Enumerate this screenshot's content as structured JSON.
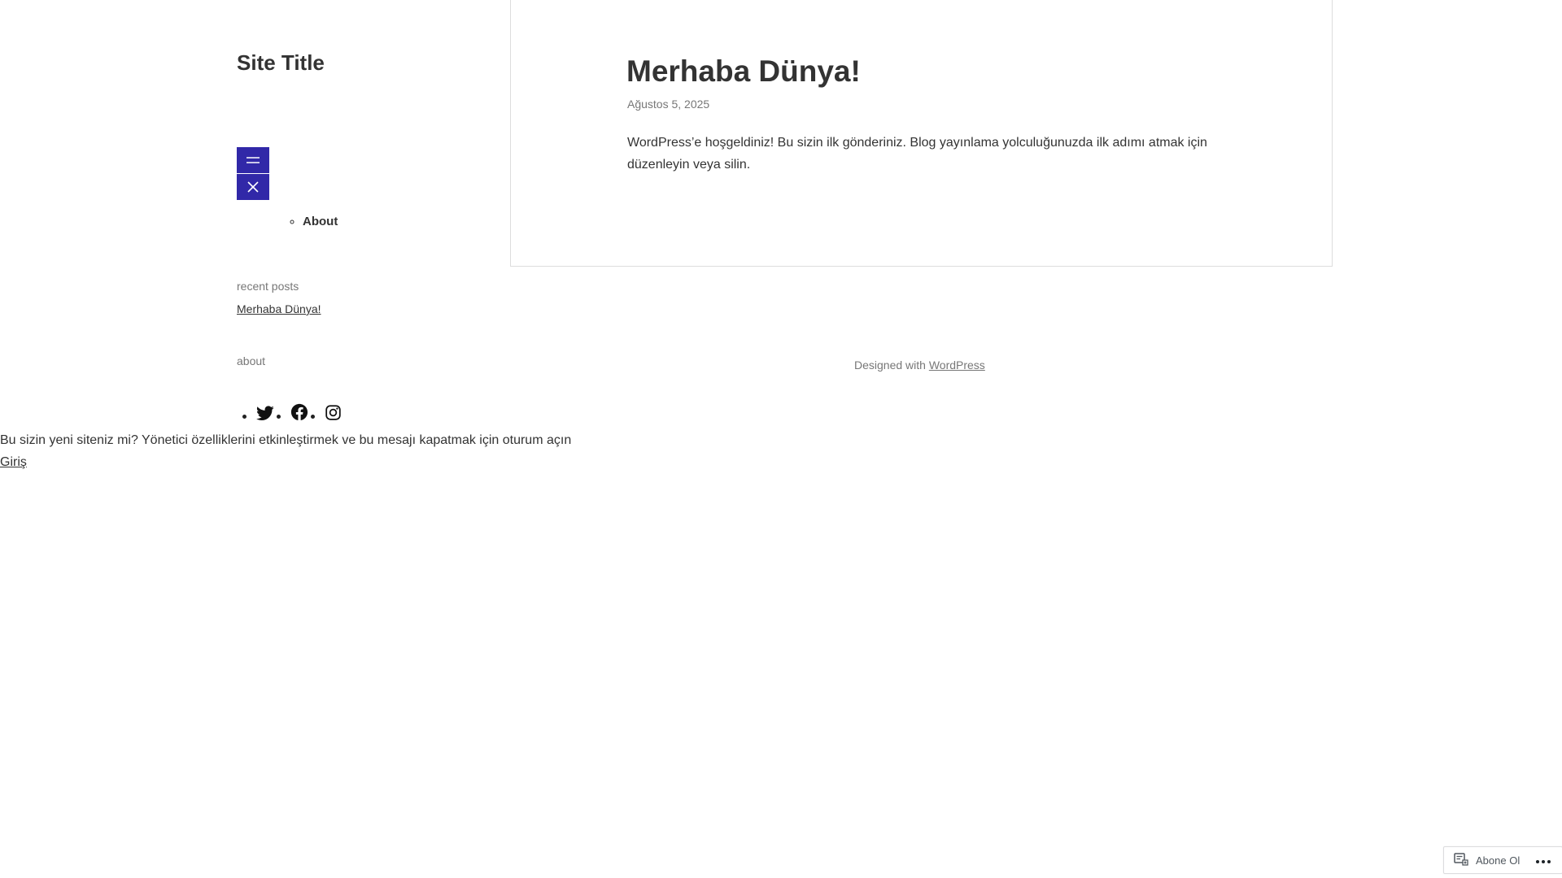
{
  "site": {
    "title": "Site Title"
  },
  "nav": {
    "menu_icon": "menu-icon",
    "close_icon": "close-icon",
    "items": [
      {
        "label": "About"
      }
    ]
  },
  "sidebar": {
    "recent_posts_label": "recent posts",
    "recent_posts": [
      {
        "label": "Merhaba Dünya!"
      }
    ],
    "about_label": "about",
    "social": [
      {
        "icon": "twitter-icon"
      },
      {
        "icon": "facebook-icon"
      },
      {
        "icon": "instagram-icon"
      }
    ]
  },
  "post": {
    "title": "Merhaba Dünya!",
    "date": "Ağustos 5, 2025",
    "body": "WordPress’e hoşgeldiniz! Bu sizin ilk gönderiniz. Blog yayınlama yolculuğunuzda ilk adımı atmak için düzenleyin veya silin."
  },
  "footer": {
    "designed_with": "Designed with",
    "link_label": "WordPress"
  },
  "notice": {
    "text": "Bu sizin yeni siteniz mi? Yönetici özelliklerini etkinleştirmek ve bu mesajı kapatmak için oturum açın",
    "login_label": "Giriş"
  },
  "subscribe": {
    "label": "Abone Ol",
    "icon": "reader-icon",
    "more_icon": "more-icon"
  },
  "colors": {
    "accent": "#3128a8",
    "text": "#333333",
    "muted": "#777777"
  }
}
